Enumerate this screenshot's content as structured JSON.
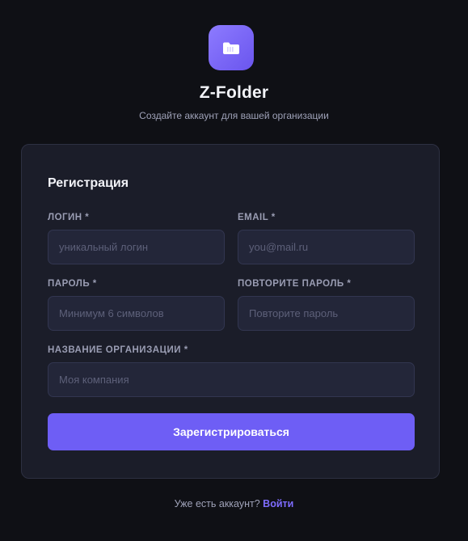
{
  "app": {
    "title": "Z-Folder",
    "subtitle": "Создайте аккаунт для вашей организации",
    "logo_icon": "folder-icon"
  },
  "form": {
    "title": "Регистрация",
    "fields": {
      "login": {
        "label": "ЛОГИН *",
        "placeholder": "уникальный логин",
        "value": ""
      },
      "email": {
        "label": "EMAIL *",
        "placeholder": "you@mail.ru",
        "value": ""
      },
      "password": {
        "label": "ПАРОЛЬ *",
        "placeholder": "Минимум 6 символов",
        "value": ""
      },
      "password_repeat": {
        "label": "ПОВТОРИТЕ ПАРОЛЬ *",
        "placeholder": "Повторите пароль",
        "value": ""
      },
      "organization": {
        "label": "НАЗВАНИЕ ОРГАНИЗАЦИИ *",
        "placeholder": "Моя компания",
        "value": ""
      }
    },
    "submit_label": "Зарегистрироваться"
  },
  "footer": {
    "text": "Уже есть аккаунт?",
    "link_label": "Войти"
  },
  "colors": {
    "accent": "#6e5ef5",
    "background": "#0f1015",
    "card": "#1b1d29",
    "link": "#7e6cff"
  }
}
